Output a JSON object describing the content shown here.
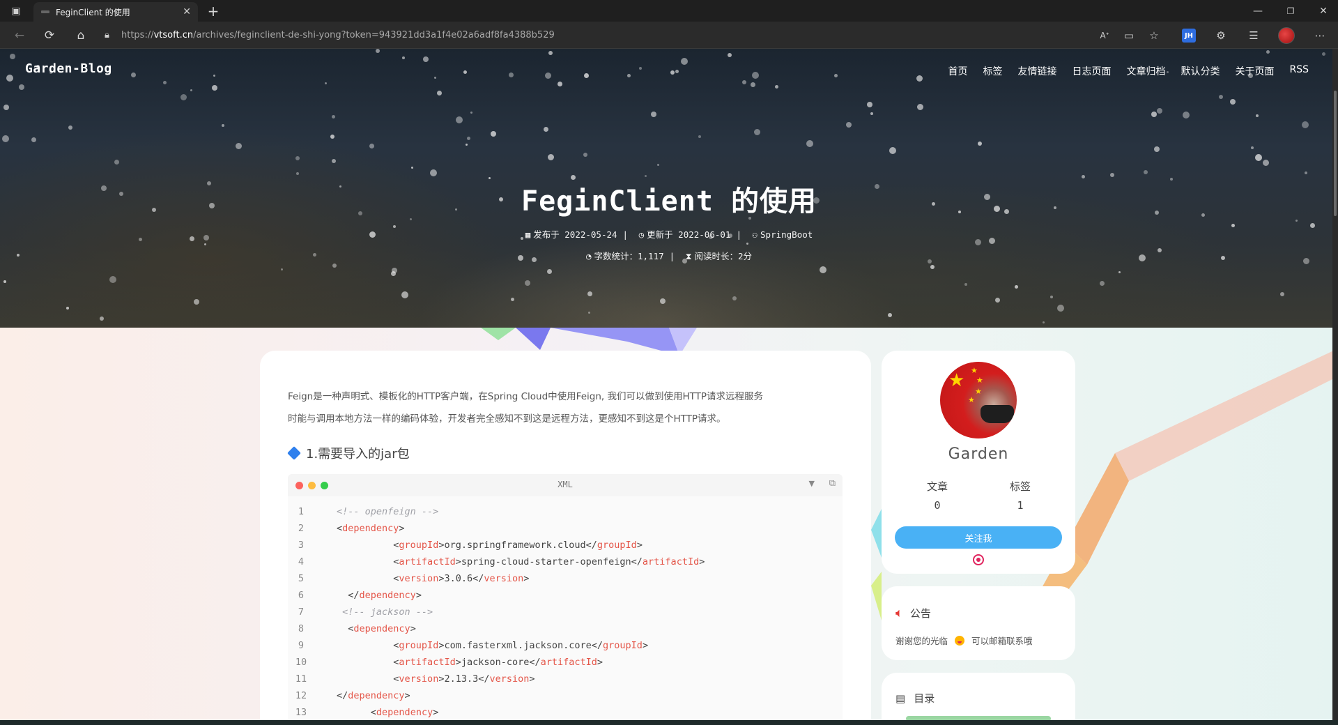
{
  "browser": {
    "tab_title": "FeginClient 的使用",
    "url_prefix": "https://",
    "url_domain": "vtsoft.cn",
    "url_path": "/archives/feginclient-de-shi-yong?token=943921dd3a1f4e02a6adf8fa4388b529",
    "extension_badge": "JH",
    "icons": [
      "back-icon",
      "refresh-icon",
      "home-icon",
      "lock-icon",
      "read-aloud-icon",
      "immersive-reader-icon",
      "favorite-add-icon",
      "extensions-icon",
      "favorites-icon",
      "more-icon"
    ]
  },
  "site": {
    "name": "Garden-Blog",
    "nav": [
      "首页",
      "标签",
      "友情链接",
      "日志页面",
      "文章归档",
      "默认分类",
      "关于页面",
      "RSS"
    ]
  },
  "post": {
    "title": "FeginClient 的使用",
    "published_label": "发布于",
    "published": "2022-05-24",
    "updated_label": "更新于",
    "updated": "2022-06-01",
    "category": "SpringBoot",
    "word_count": "字数统计：1,117",
    "read_time": "阅读时长：2分",
    "intro_line1": "Feign是一种声明式、模板化的HTTP客户端，在Spring Cloud中使用Feign, 我们可以做到使用HTTP请求远程服务",
    "intro_line2": "时能与调用本地方法一样的编码体验，开发者完全感知不到这是远程方法，更感知不到这是个HTTP请求。",
    "heading1": "1.需要导入的jar包",
    "code_lang": "XML",
    "code_lines": [
      {
        "n": "1",
        "indent": "",
        "parts": [
          [
            "cmt",
            "<!-- openfeign -->"
          ]
        ]
      },
      {
        "n": "2",
        "indent": "",
        "parts": [
          [
            "txt",
            "<"
          ],
          [
            "tag",
            "dependency"
          ],
          [
            "txt",
            ">"
          ]
        ]
      },
      {
        "n": "3",
        "indent": "          ",
        "parts": [
          [
            "txt",
            "<"
          ],
          [
            "tag",
            "groupId"
          ],
          [
            "txt",
            ">org.springframework.cloud</"
          ],
          [
            "tag",
            "groupId"
          ],
          [
            "txt",
            ">"
          ]
        ]
      },
      {
        "n": "4",
        "indent": "          ",
        "parts": [
          [
            "txt",
            "<"
          ],
          [
            "tag",
            "artifactId"
          ],
          [
            "txt",
            ">spring-cloud-starter-openfeign</"
          ],
          [
            "tag",
            "artifactId"
          ],
          [
            "txt",
            ">"
          ]
        ]
      },
      {
        "n": "5",
        "indent": "          ",
        "parts": [
          [
            "txt",
            "<"
          ],
          [
            "tag",
            "version"
          ],
          [
            "txt",
            ">3.0.6</"
          ],
          [
            "tag",
            "version"
          ],
          [
            "txt",
            ">"
          ]
        ]
      },
      {
        "n": "6",
        "indent": "  ",
        "parts": [
          [
            "txt",
            "</"
          ],
          [
            "tag",
            "dependency"
          ],
          [
            "txt",
            ">"
          ]
        ]
      },
      {
        "n": "7",
        "indent": " ",
        "parts": [
          [
            "cmt",
            "<!-- jackson -->"
          ]
        ]
      },
      {
        "n": "8",
        "indent": "  ",
        "parts": [
          [
            "txt",
            "<"
          ],
          [
            "tag",
            "dependency"
          ],
          [
            "txt",
            ">"
          ]
        ]
      },
      {
        "n": "9",
        "indent": "          ",
        "parts": [
          [
            "txt",
            "<"
          ],
          [
            "tag",
            "groupId"
          ],
          [
            "txt",
            ">com.fasterxml.jackson.core</"
          ],
          [
            "tag",
            "groupId"
          ],
          [
            "txt",
            ">"
          ]
        ]
      },
      {
        "n": "10",
        "indent": "          ",
        "parts": [
          [
            "txt",
            "<"
          ],
          [
            "tag",
            "artifactId"
          ],
          [
            "txt",
            ">jackson-core</"
          ],
          [
            "tag",
            "artifactId"
          ],
          [
            "txt",
            ">"
          ]
        ]
      },
      {
        "n": "11",
        "indent": "          ",
        "parts": [
          [
            "txt",
            "<"
          ],
          [
            "tag",
            "version"
          ],
          [
            "txt",
            ">2.13.3</"
          ],
          [
            "tag",
            "version"
          ],
          [
            "txt",
            ">"
          ]
        ]
      },
      {
        "n": "12",
        "indent": "",
        "parts": [
          [
            "txt",
            "</"
          ],
          [
            "tag",
            "dependency"
          ],
          [
            "txt",
            ">"
          ]
        ]
      },
      {
        "n": "13",
        "indent": "      ",
        "parts": [
          [
            "txt",
            "<"
          ],
          [
            "tag",
            "dependency"
          ],
          [
            "txt",
            ">"
          ]
        ]
      }
    ]
  },
  "sidebar": {
    "author": "Garden",
    "stats": [
      {
        "label": "文章",
        "value": "0"
      },
      {
        "label": "标签",
        "value": "1"
      }
    ],
    "follow_label": "关注我",
    "notice_title": "公告",
    "notice_text_a": "谢谢您的光临",
    "notice_text_b": "可以邮箱联系哦",
    "toc_title": "目录"
  },
  "colors": {
    "accent": "#49b1f5",
    "code_tag": "#e45649",
    "code_comment": "#a0a1a7",
    "heading_icon": "#2f80ed"
  }
}
